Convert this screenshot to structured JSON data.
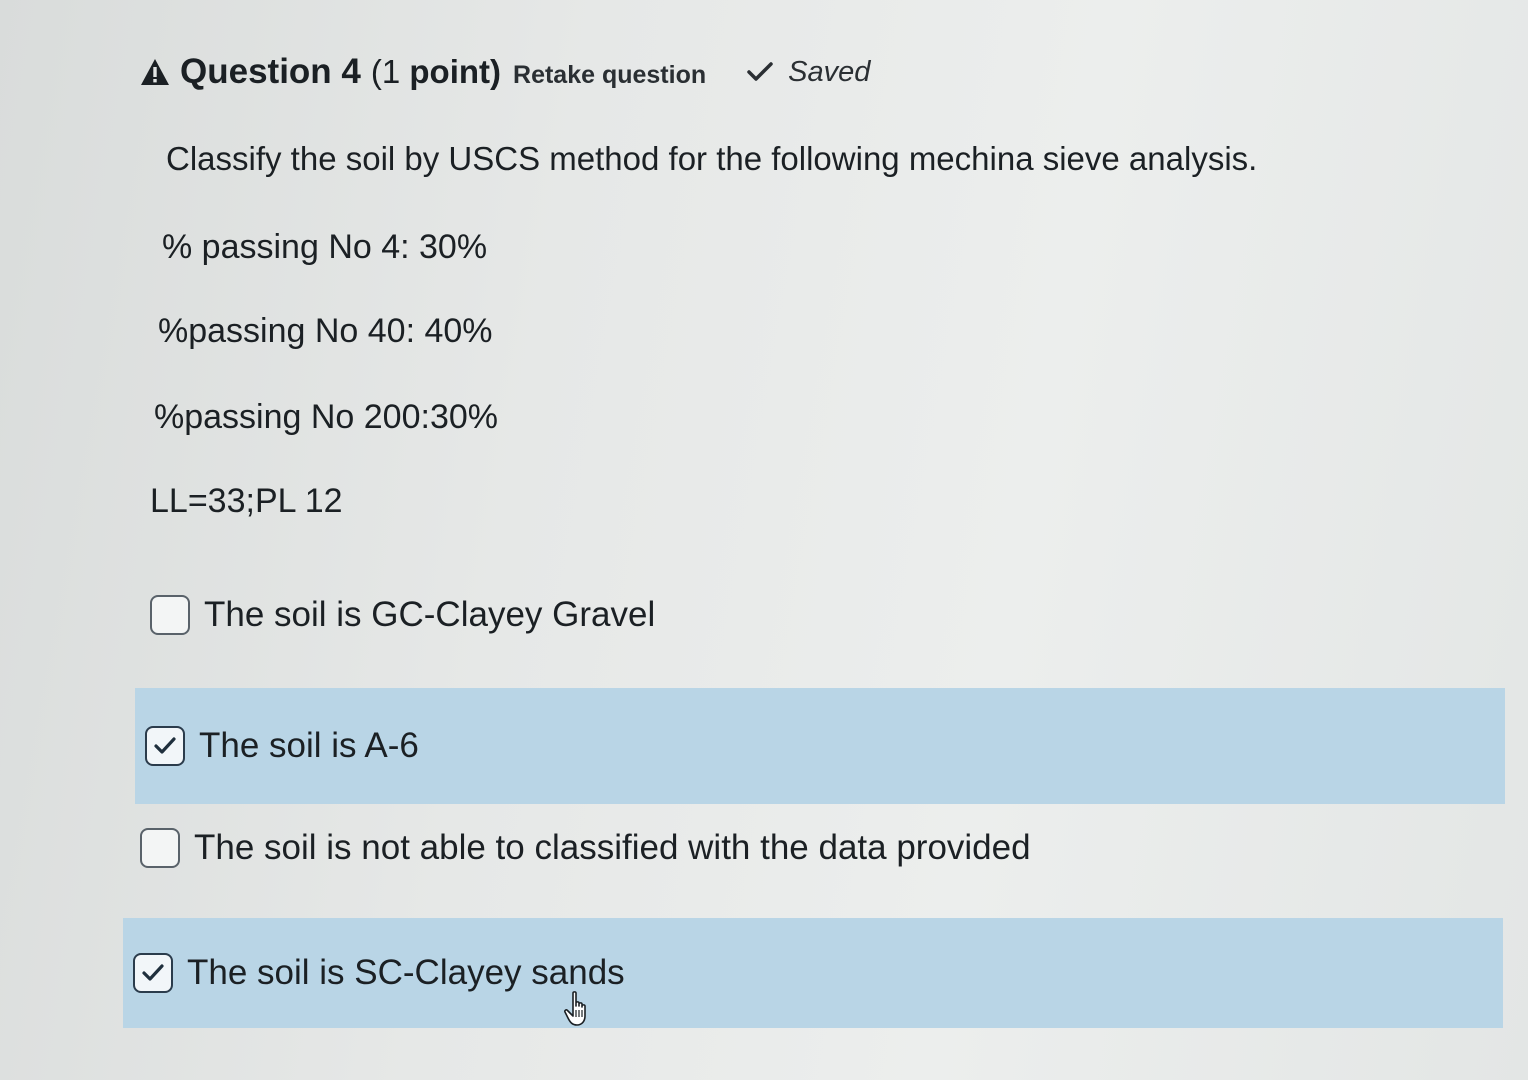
{
  "question": {
    "warning_icon": "warning-triangle-icon",
    "title": "Question 4",
    "points_open": "(1 ",
    "points_word": "point)",
    "retake_label": "Retake question",
    "saved_icon": "checkmark-icon",
    "saved_label": "Saved",
    "prompt": "Classify the soil by USCS method for the following mechina sieve analysis.",
    "data_lines": [
      "% passing No 4: 30%",
      "%passing No 40: 40%",
      "%passing No 200:30%",
      "LL=33;PL 12"
    ]
  },
  "options": [
    {
      "label": "The soil is GC-Clayey Gravel",
      "checked": false
    },
    {
      "label": "The soil is A-6",
      "checked": true
    },
    {
      "label": "The soil is not able to classified with the data provided",
      "checked": false
    },
    {
      "label": "The soil is SC-Clayey sands",
      "checked": true
    }
  ],
  "colors": {
    "selected_background": "#b9d5e6",
    "text": "#1b2024",
    "checkbox_border": "#59626a"
  }
}
